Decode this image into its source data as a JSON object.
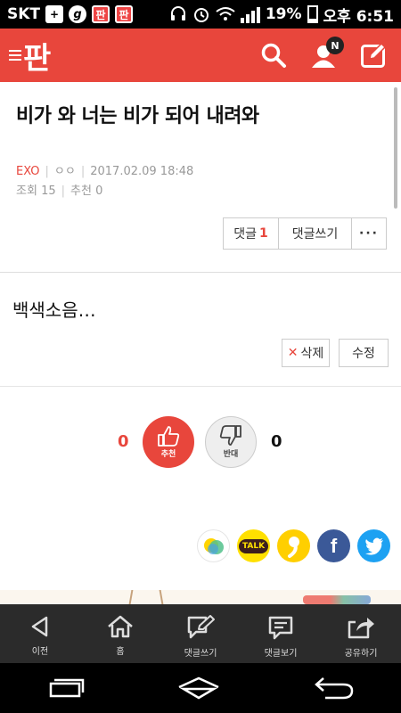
{
  "status_bar": {
    "carrier": "SKT",
    "battery_percent": "19%",
    "time": "오후 6:51",
    "battery_level": 0.19
  },
  "header": {
    "logo": "판",
    "notification_badge": "N"
  },
  "post": {
    "title": "비가 와 너는 비가 되어 내려와",
    "category": "EXO",
    "author": "ㅇㅇ",
    "datetime": "2017.02.09 18:48",
    "views_label": "조회",
    "views": "15",
    "recommend_label": "추천",
    "recommend": "0",
    "comment_label": "댓글",
    "comment_count": "1",
    "write_comment_label": "댓글쓰기",
    "more_label": "···",
    "body": "백색소음…",
    "delete_label": "삭제",
    "edit_label": "수정"
  },
  "votes": {
    "up_count": "0",
    "up_label": "추천",
    "down_count": "0",
    "down_label": "반대"
  },
  "share": {
    "kakao_label": "TALK",
    "facebook_label": "f"
  },
  "bottom_toolbar": [
    {
      "label": "이전",
      "icon": "back-arrow-icon"
    },
    {
      "label": "홈",
      "icon": "home-icon"
    },
    {
      "label": "댓글쓰기",
      "icon": "write-comment-icon"
    },
    {
      "label": "댓글보기",
      "icon": "view-comments-icon"
    },
    {
      "label": "공유하기",
      "icon": "share-icon"
    }
  ],
  "colors": {
    "brand": "#e8463c",
    "toolbar": "#2b2b2b"
  }
}
